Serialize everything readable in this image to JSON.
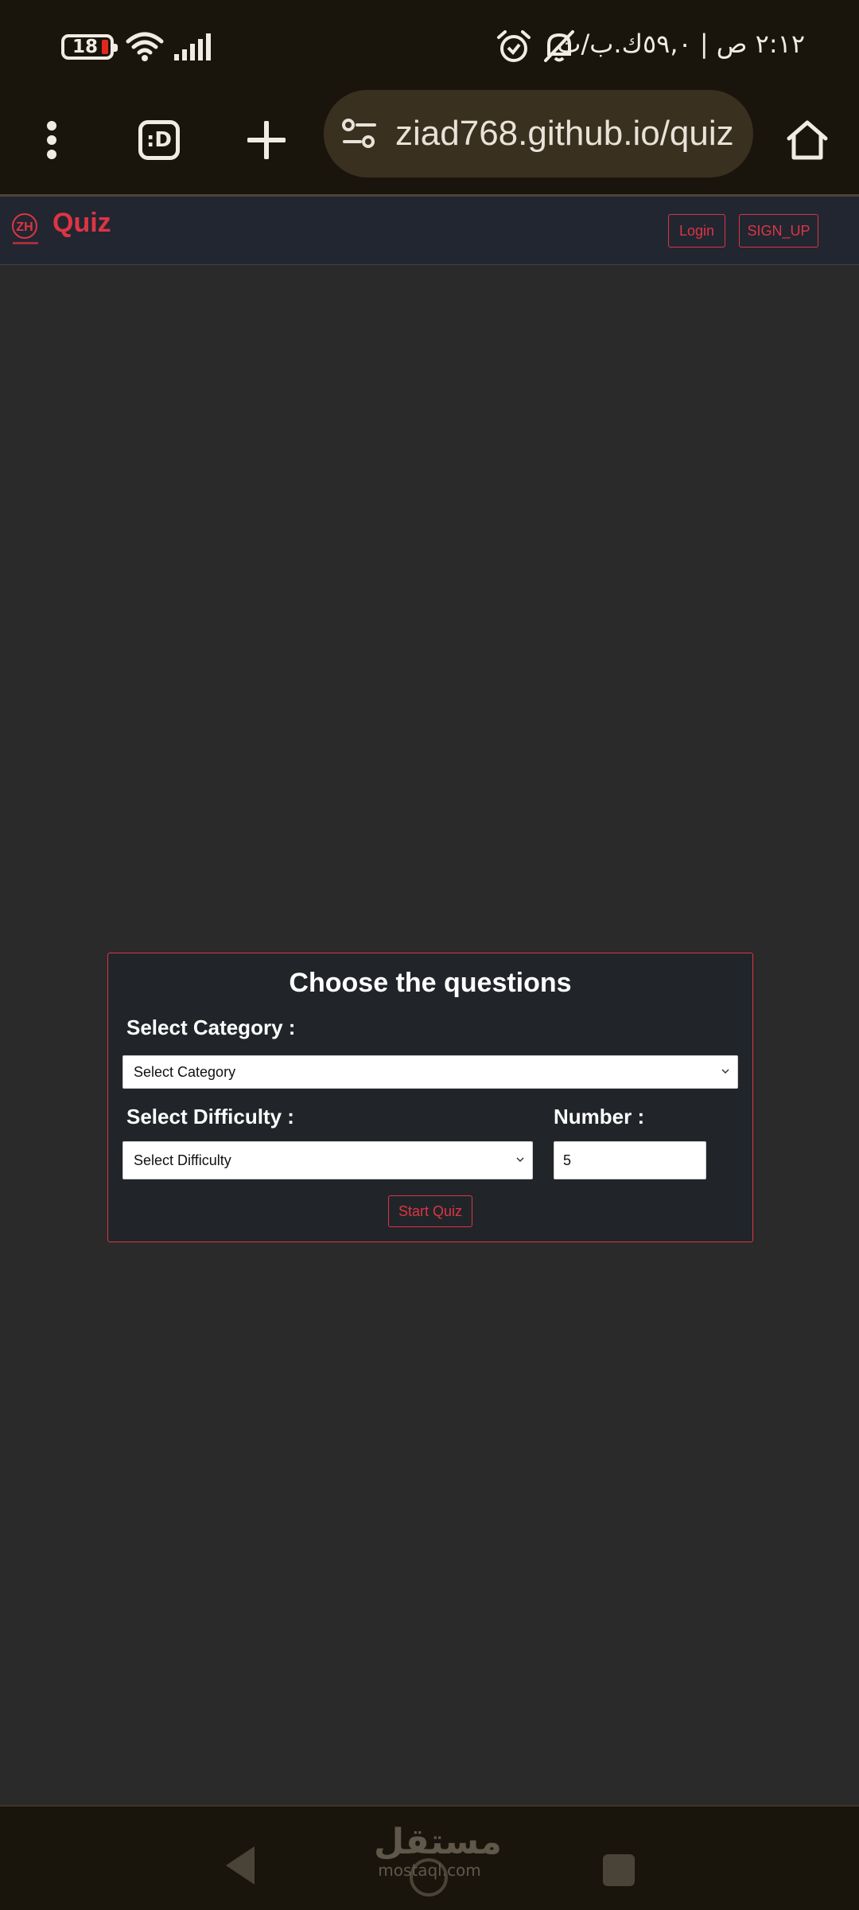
{
  "status_bar": {
    "battery_level": "18",
    "time": "٢:١٢ ص | ٥٩,٠ك.ب/ث",
    "icons": [
      "battery-icon",
      "wifi-icon",
      "signal-icon",
      "alarm-icon",
      "mute-icon"
    ]
  },
  "browser": {
    "tabs_label": ":D",
    "url": "ziad768.github.io/quiz",
    "icons": [
      "menu-icon",
      "tabs-icon",
      "plus-icon",
      "tune-icon",
      "home-icon"
    ]
  },
  "site": {
    "brand": "Quiz",
    "login_label": "Login",
    "signup_label": "SIGN_UP",
    "accent_color": "#dc3545"
  },
  "quiz_form": {
    "title": "Choose the questions",
    "category_label": "Select Category :",
    "category_selected": "Select Category",
    "difficulty_label": "Select Difficulty :",
    "difficulty_selected": "Select Difficulty",
    "number_label": "Number :",
    "number_value": "5",
    "start_label": "Start Quiz"
  },
  "bottom_nav": {
    "watermark_ar": "مستقل",
    "watermark_en": "mostaql.com",
    "icons": [
      "back-icon",
      "home-circle-icon",
      "recents-icon"
    ]
  }
}
